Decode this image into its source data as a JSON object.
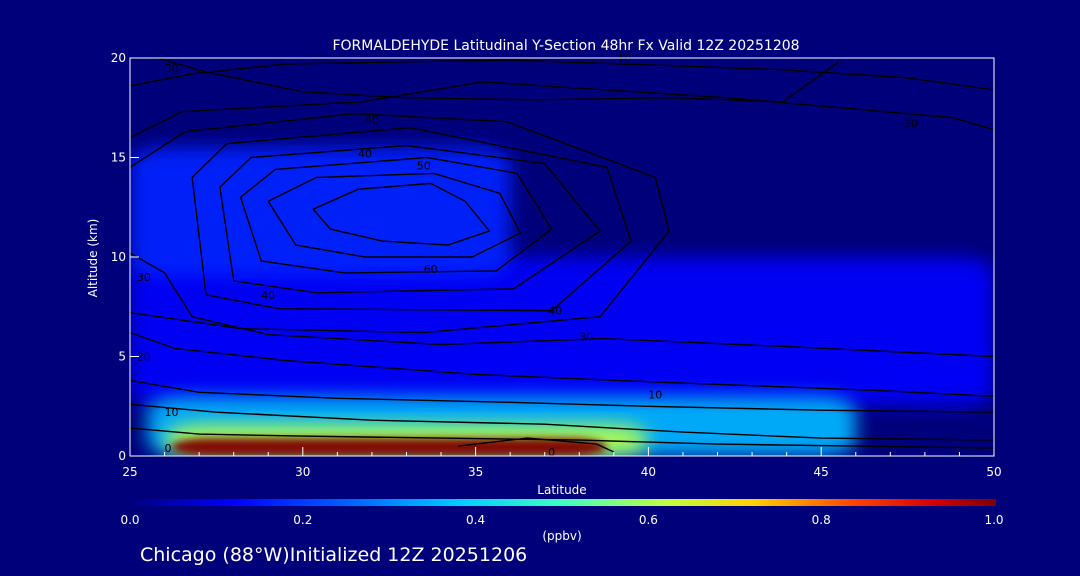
{
  "title": "FORMALDEHYDE Latitudinal Y-Section 48hr  Fx Valid 12Z 20251208",
  "footer": "Chicago (88°W)Initialized 12Z 20251206",
  "colors": {
    "background": "#00007a",
    "contour": "#000000",
    "text": "#ffffff"
  },
  "chart_data": {
    "type": "heatmap",
    "xlabel": "Latitude",
    "ylabel": "Altitude (km)",
    "xlim": [
      25,
      50
    ],
    "ylim": [
      0,
      20
    ],
    "x_ticks": [
      "25",
      "30",
      "35",
      "40",
      "45",
      "50"
    ],
    "y_ticks": [
      "0",
      "5",
      "10",
      "15",
      "20"
    ],
    "colorbar": {
      "label": "(ppbv)",
      "range": [
        0.0,
        1.0
      ],
      "ticks": [
        "0.0",
        "0.2",
        "0.4",
        "0.6",
        "0.8",
        "1.0"
      ],
      "colors": [
        "#000080",
        "#0000ff",
        "#0080ff",
        "#00ffff",
        "#80ff80",
        "#ffff00",
        "#ff8000",
        "#ff0000",
        "#800000"
      ]
    },
    "field_regions": [
      {
        "lat": [
          26.2,
          38.8
        ],
        "alt": [
          0.0,
          0.9
        ],
        "value": 1.0
      },
      {
        "lat": [
          26.0,
          40.0
        ],
        "alt": [
          0.0,
          1.6
        ],
        "value": 0.55
      },
      {
        "lat": [
          25.5,
          46.0
        ],
        "alt": [
          0.0,
          3.0
        ],
        "value": 0.3
      },
      {
        "lat": [
          25.0,
          50.0
        ],
        "alt": [
          2.5,
          10.0
        ],
        "value": 0.12
      },
      {
        "lat": [
          25.0,
          36.0
        ],
        "alt": [
          9.0,
          15.5
        ],
        "value": 0.16
      }
    ],
    "contour_labels": [
      {
        "lat": 32.0,
        "alt": 16.9,
        "text": "40"
      },
      {
        "lat": 31.8,
        "alt": 15.2,
        "text": "40"
      },
      {
        "lat": 33.5,
        "alt": 14.6,
        "text": "50"
      },
      {
        "lat": 33.7,
        "alt": 9.4,
        "text": "60"
      },
      {
        "lat": 29.0,
        "alt": 8.1,
        "text": "40"
      },
      {
        "lat": 37.3,
        "alt": 7.3,
        "text": "40"
      },
      {
        "lat": 38.2,
        "alt": 6.0,
        "text": "30"
      },
      {
        "lat": 47.6,
        "alt": 16.7,
        "text": "30"
      },
      {
        "lat": 40.2,
        "alt": 3.1,
        "text": "10"
      },
      {
        "lat": 37.2,
        "alt": 0.2,
        "text": "0"
      },
      {
        "lat": 26.1,
        "alt": 0.4,
        "text": "0"
      },
      {
        "lat": 26.2,
        "alt": 19.5,
        "text": "30"
      },
      {
        "lat": 25.4,
        "alt": 9.0,
        "text": "30"
      },
      {
        "lat": 25.4,
        "alt": 5.0,
        "text": "20"
      },
      {
        "lat": 26.2,
        "alt": 2.2,
        "text": "10"
      },
      {
        "lat": 39.3,
        "alt": 20.0,
        "text": "10"
      }
    ]
  }
}
